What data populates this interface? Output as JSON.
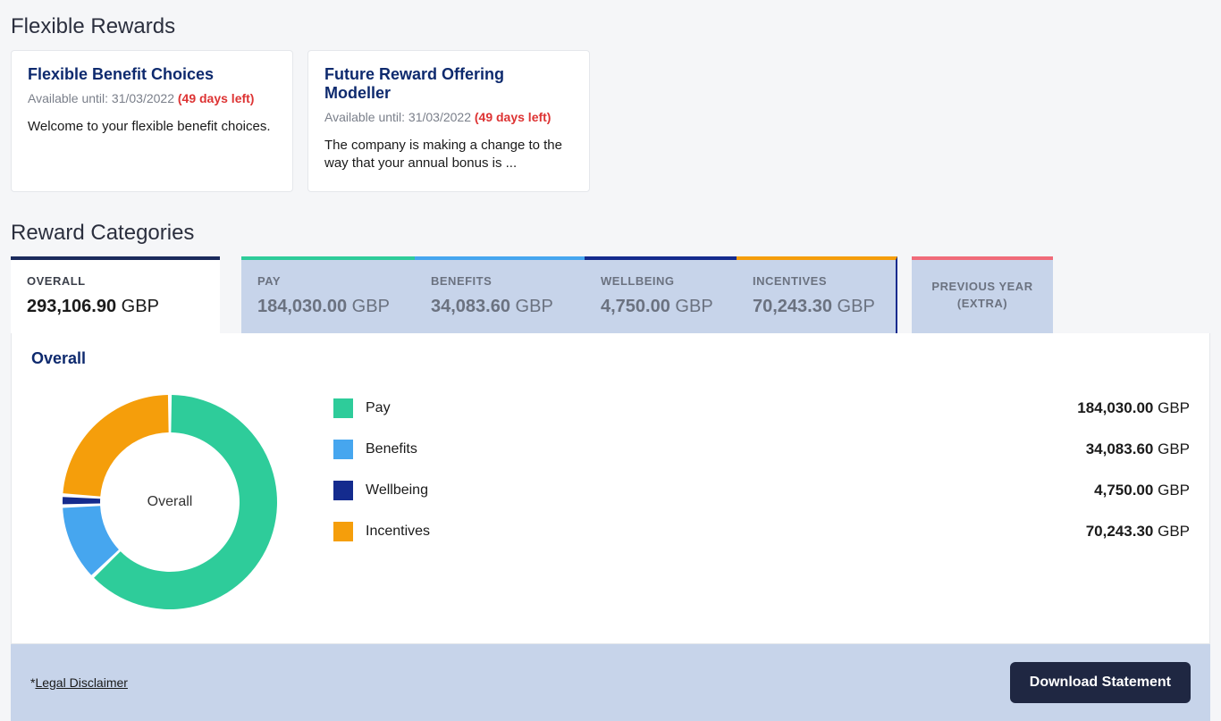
{
  "flexible_rewards": {
    "title": "Flexible Rewards",
    "cards": [
      {
        "title": "Flexible Benefit Choices",
        "available_prefix": "Available until: 31/03/2022",
        "days_left": "(49 days left)",
        "desc": "Welcome to your flexible benefit choices."
      },
      {
        "title": "Future Reward Offering Modeller",
        "available_prefix": "Available until: 31/03/2022",
        "days_left": "(49 days left)",
        "desc": "The company is making a change to the way that your annual bonus is ..."
      }
    ]
  },
  "categories": {
    "title": "Reward Categories",
    "tabs": {
      "overall": {
        "label": "OVERALL",
        "amount": "293,106.90",
        "currency": "GBP"
      },
      "pay": {
        "label": "PAY",
        "amount": "184,030.00",
        "currency": "GBP",
        "color": "#2ecc9a"
      },
      "benefits": {
        "label": "BENEFITS",
        "amount": "34,083.60",
        "currency": "GBP",
        "color": "#46a6ef"
      },
      "wellbeing": {
        "label": "WELLBEING",
        "amount": "4,750.00",
        "currency": "GBP",
        "color": "#142b8e"
      },
      "incentives": {
        "label": "INCENTIVES",
        "amount": "70,243.30",
        "currency": "GBP",
        "color": "#f59e0b"
      },
      "prev": {
        "label": "PREVIOUS YEAR (EXTRA)"
      }
    }
  },
  "panel": {
    "heading": "Overall",
    "center_label": "Overall",
    "legend": [
      {
        "name": "Pay",
        "amount": "184,030.00",
        "currency": "GBP",
        "color": "#2ecc9a"
      },
      {
        "name": "Benefits",
        "amount": "34,083.60",
        "currency": "GBP",
        "color": "#46a6ef"
      },
      {
        "name": "Wellbeing",
        "amount": "4,750.00",
        "currency": "GBP",
        "color": "#142b8e"
      },
      {
        "name": "Incentives",
        "amount": "70,243.30",
        "currency": "GBP",
        "color": "#f59e0b"
      }
    ]
  },
  "chart_data": {
    "type": "pie",
    "title": "Overall",
    "series": [
      {
        "name": "Pay",
        "value": 184030.0,
        "color": "#2ecc9a"
      },
      {
        "name": "Benefits",
        "value": 34083.6,
        "color": "#46a6ef"
      },
      {
        "name": "Wellbeing",
        "value": 4750.0,
        "color": "#142b8e"
      },
      {
        "name": "Incentives",
        "value": 70243.3,
        "color": "#f59e0b"
      }
    ],
    "total": 293106.9,
    "currency": "GBP"
  },
  "footer": {
    "legal_prefix": "*",
    "legal_link": "Legal Disclaimer",
    "download": "Download Statement"
  }
}
